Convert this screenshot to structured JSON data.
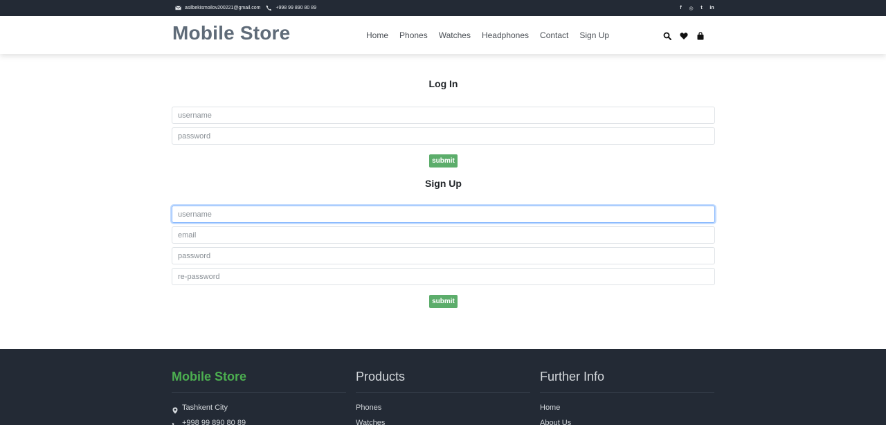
{
  "topbar": {
    "email": "asilbekismoilov200221@gmail.com",
    "phone": "+998 99 890 80 89",
    "social": [
      "f",
      "◎",
      "t",
      "in"
    ]
  },
  "header": {
    "brand": "Mobile Store",
    "nav": [
      "Home",
      "Phones",
      "Watches",
      "Headphones",
      "Contact",
      "Sign Up"
    ],
    "icons": [
      "search-icon",
      "heart-icon",
      "shopping-bag-icon"
    ]
  },
  "login": {
    "title": "Log In",
    "username_placeholder": "username",
    "password_placeholder": "password",
    "submit_label": "submit"
  },
  "signup": {
    "title": "Sign Up",
    "username_placeholder": "username",
    "email_placeholder": "email",
    "password_placeholder": "password",
    "repassword_placeholder": "re-password",
    "submit_label": "submit"
  },
  "footer": {
    "brand": {
      "title": "Mobile Store",
      "city": "Tashkent City",
      "phone": "+998 99 890 80 89"
    },
    "products": {
      "title": "Products",
      "items": [
        "Phones",
        "Watches"
      ]
    },
    "further": {
      "title": "Further Info",
      "items": [
        "Home",
        "About Us"
      ]
    }
  },
  "colors": {
    "dark": "#232a35",
    "submit_green": "#5cad6b",
    "brand_green": "#4caf50",
    "brand_gray": "#5f6b78"
  }
}
